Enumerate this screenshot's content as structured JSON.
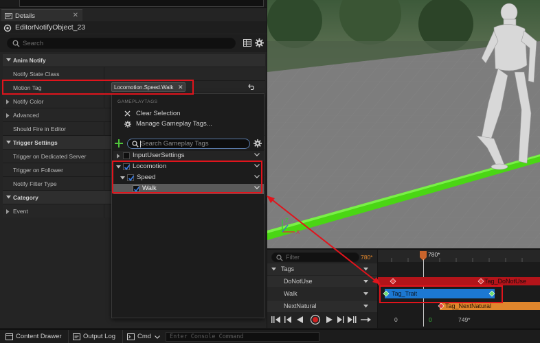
{
  "details": {
    "tab_title": "Details",
    "object_name": "EditorNotifyObject_23",
    "search_placeholder": "Search"
  },
  "properties": {
    "anim_notify": "Anim Notify",
    "notify_state_class": "Notify State Class",
    "motion_tag": "Motion Tag",
    "motion_tag_value": "Locomotion.Speed.Walk",
    "notify_color": "Notify Color",
    "advanced": "Advanced",
    "should_fire_in_editor": "Should Fire in Editor",
    "trigger_settings": "Trigger Settings",
    "trigger_on_dedicated_server": "Trigger on Dedicated Server",
    "trigger_on_follower": "Trigger on Follower",
    "notify_filter_type": "Notify Filter Type",
    "category": "Category",
    "event": "Event"
  },
  "tag_popup": {
    "header": "GAMEPLAYTAGS",
    "clear_selection": "Clear Selection",
    "manage_tags": "Manage Gameplay Tags...",
    "search_placeholder": "Search Gameplay Tags",
    "tree": [
      {
        "label": "InputUserSettings",
        "checked": false
      },
      {
        "label": "Locomotion",
        "checked": true
      },
      {
        "label": "Speed",
        "checked": true
      },
      {
        "label": "Walk",
        "checked": true
      }
    ]
  },
  "sequencer": {
    "filter_placeholder": "Filter",
    "current_frame": "780*",
    "tracks_header": "Tags",
    "tracks": [
      "DoNotUse",
      "Walk",
      "NextNatural"
    ],
    "events": {
      "do_not_use": "Tag_DoNotUse",
      "trait": "Tag_Trait",
      "next_natural": "Tag_NextNatural"
    },
    "playhead_label": "780*",
    "range_start": "0",
    "range_mid": "0",
    "range_end": "749*"
  },
  "status_bar": {
    "content_drawer": "Content Drawer",
    "output_log": "Output Log",
    "cmd": "Cmd",
    "console_placeholder": "Enter Console Command"
  },
  "colors": {
    "accent_red": "#e0141c",
    "check_blue": "#3a7be0",
    "selection_blue": "#1c78d2",
    "green_track": "#4ad614",
    "orange": "#e0862c",
    "darkred_track": "#b3141a"
  }
}
